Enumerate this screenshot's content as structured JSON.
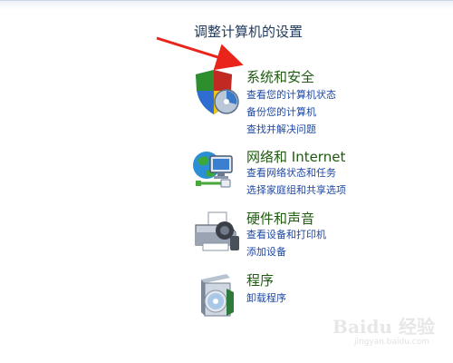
{
  "page": {
    "title": "调整计算机的设置"
  },
  "categories": [
    {
      "heading": "系统和安全",
      "links": [
        "查看您的计算机状态",
        "备份您的计算机",
        "查找并解决问题"
      ],
      "icon": "shield-icon"
    },
    {
      "heading": "网络和 Internet",
      "links": [
        "查看网络状态和任务",
        "选择家庭组和共享选项"
      ],
      "icon": "network-globe-icon"
    },
    {
      "heading": "硬件和声音",
      "links": [
        "查看设备和打印机",
        "添加设备"
      ],
      "icon": "printer-icon"
    },
    {
      "heading": "程序",
      "links": [
        "卸载程序"
      ],
      "icon": "programs-box-icon"
    }
  ],
  "annotation": {
    "arrow_color": "#e8241b"
  },
  "watermark": {
    "text": "Baidu 经验",
    "subtext": "jingyan.baidu.com"
  }
}
